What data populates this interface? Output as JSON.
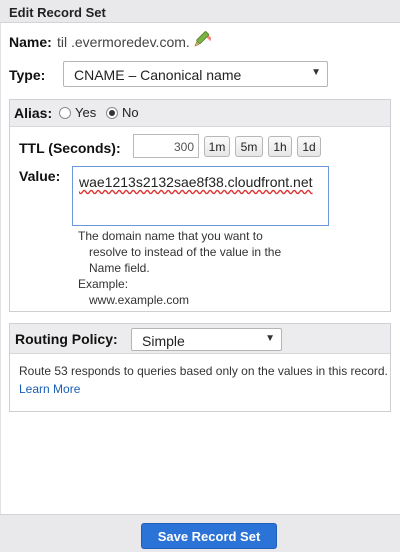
{
  "header": {
    "title": "Edit Record Set"
  },
  "name": {
    "label": "Name:",
    "value": "til .evermoredev.com."
  },
  "type": {
    "label": "Type:",
    "selected": "CNAME – Canonical name"
  },
  "alias": {
    "label": "Alias:",
    "options": [
      "Yes",
      "No"
    ],
    "selected": "No"
  },
  "ttl": {
    "label": "TTL (Seconds):",
    "value": "300",
    "buttons": [
      "1m",
      "5m",
      "1h",
      "1d"
    ]
  },
  "value": {
    "label": "Value:",
    "text": "wae1213s2132sae8f38.cloudfront.net",
    "help_lines": [
      "The domain name that you want to",
      "resolve to instead of the value in the",
      "Name field."
    ],
    "example_label": "Example:",
    "example_value": "www.example.com"
  },
  "routing": {
    "label": "Routing Policy:",
    "selected": "Simple",
    "description": "Route 53 responds to queries based only on the values in this record.",
    "learn_more": "Learn More"
  },
  "footer": {
    "save_label": "Save Record Set"
  },
  "colors": {
    "accent": "#2b73d6",
    "header_bg": "#e9e9ec"
  }
}
